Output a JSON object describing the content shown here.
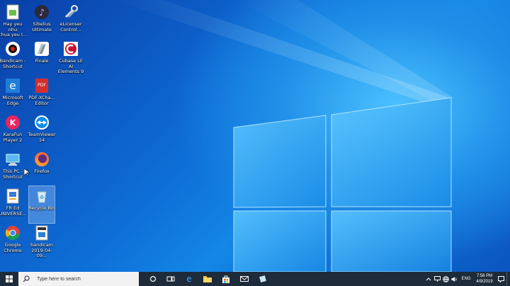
{
  "desktop": {
    "icons": [
      {
        "name": "desktop-icon-file",
        "label": "Hay yeu nhu\nchua yeu l..."
      },
      {
        "name": "desktop-icon-sibelius",
        "label": "Sibelius\nUltimate"
      },
      {
        "name": "desktop-icon-elicenser",
        "label": "eLicenser\nControl..."
      },
      {
        "name": "desktop-icon-bandicam",
        "label": "Bandicam -\nShortcut"
      },
      {
        "name": "desktop-icon-finale",
        "label": "Finale"
      },
      {
        "name": "desktop-icon-cubase",
        "label": "Cubase LE AI\nElements 9"
      },
      {
        "name": "desktop-icon-edge",
        "label": "Microsoft\nEdge"
      },
      {
        "name": "desktop-icon-pdfxchange",
        "label": "PDF-XCha...\nEditor"
      },
      {
        "name": "desktop-icon-karafun",
        "label": "KaraFun\nPlayer 2"
      },
      {
        "name": "desktop-icon-teamviewer",
        "label": "TeamViewer\n14"
      },
      {
        "name": "desktop-icon-thispc",
        "label": "This PC -\nShortcut"
      },
      {
        "name": "desktop-icon-firefox",
        "label": "Firefox"
      },
      {
        "name": "desktop-icon-universe",
        "label": "FR Ed\nUNIVERSE..."
      },
      {
        "name": "desktop-icon-recyclebin",
        "label": "Recycle Bin"
      },
      {
        "name": "desktop-icon-chrome",
        "label": "Google\nChrome"
      },
      {
        "name": "desktop-icon-video",
        "label": "bandicam\n2019-04-09..."
      }
    ],
    "pdf_badge": "PDF",
    "karafun_letter": "K"
  },
  "taskbar": {
    "search_placeholder": "Type here to search",
    "language": "ENG",
    "time": "7:56 PM",
    "date": "4/9/2019"
  },
  "colors": {
    "taskbar": "#1e2b3a",
    "accent": "#0078d7"
  }
}
